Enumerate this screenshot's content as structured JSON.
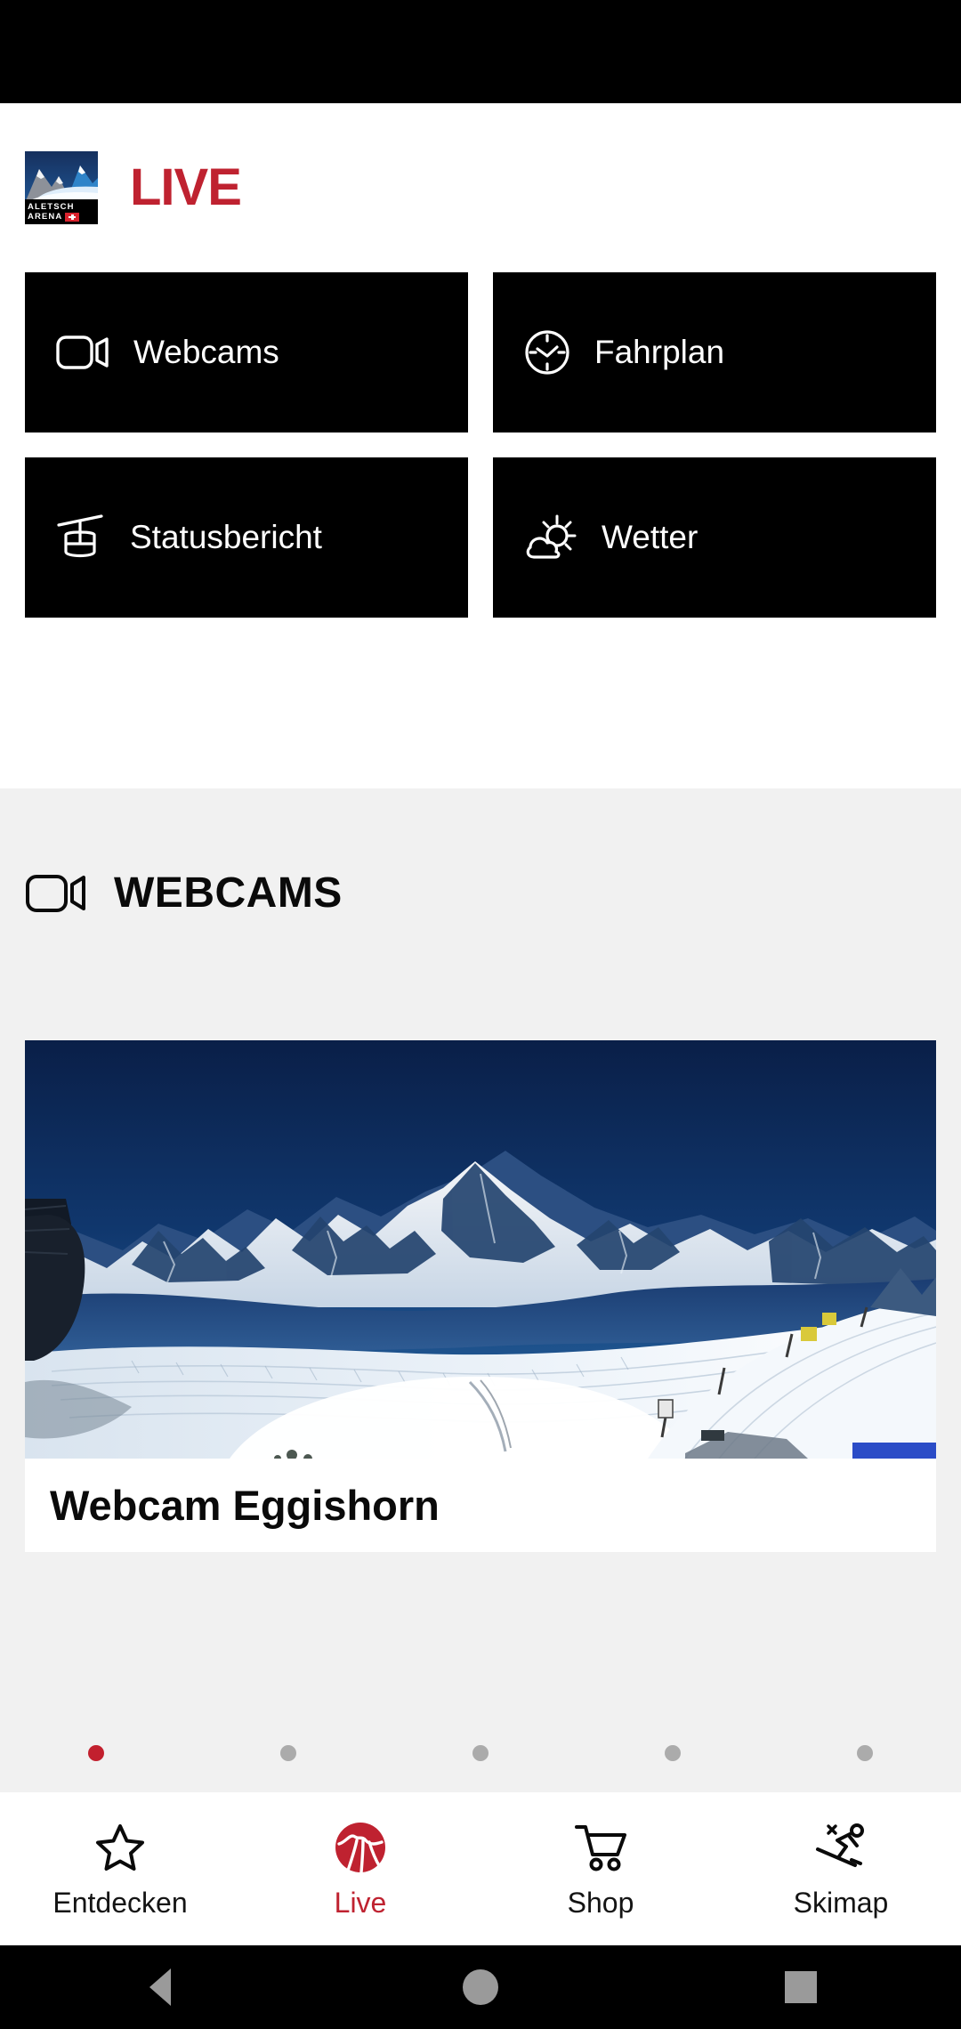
{
  "app": {
    "brand_name": "ALETSCH ARENA",
    "logo_line1": "ALETSCH",
    "logo_line2": "ARENA",
    "title": "LIVE",
    "accent_color": "#bf2230",
    "tile_bg_color": "#000000",
    "section_bg_color": "#f1f1f1"
  },
  "tiles": [
    {
      "label": "Webcams",
      "icon": "video-camera-icon"
    },
    {
      "label": "Fahrplan",
      "icon": "clock-icon"
    },
    {
      "label": "Statusbericht",
      "icon": "gondola-icon"
    },
    {
      "label": "Wetter",
      "icon": "sun-cloud-icon"
    }
  ],
  "webcams_section": {
    "heading": "WEBCAMS",
    "heading_icon": "video-camera-icon",
    "cards": [
      {
        "caption": "Webcam Eggishorn"
      }
    ],
    "carousel": {
      "count": 5,
      "active_index": 0,
      "active_color": "#c2202e",
      "inactive_color": "#ababab"
    }
  },
  "tabbar": {
    "active_index": 1,
    "items": [
      {
        "label": "Entdecken",
        "icon": "star-icon"
      },
      {
        "label": "Live",
        "icon": "aletsch-live-logo-icon"
      },
      {
        "label": "Shop",
        "icon": "shopping-cart-icon"
      },
      {
        "label": "Skimap",
        "icon": "skier-icon"
      }
    ]
  },
  "system_navbar": {
    "items": [
      {
        "name": "back",
        "icon": "triangle-back-icon"
      },
      {
        "name": "home",
        "icon": "circle-home-icon"
      },
      {
        "name": "recents",
        "icon": "square-recents-icon"
      }
    ]
  }
}
